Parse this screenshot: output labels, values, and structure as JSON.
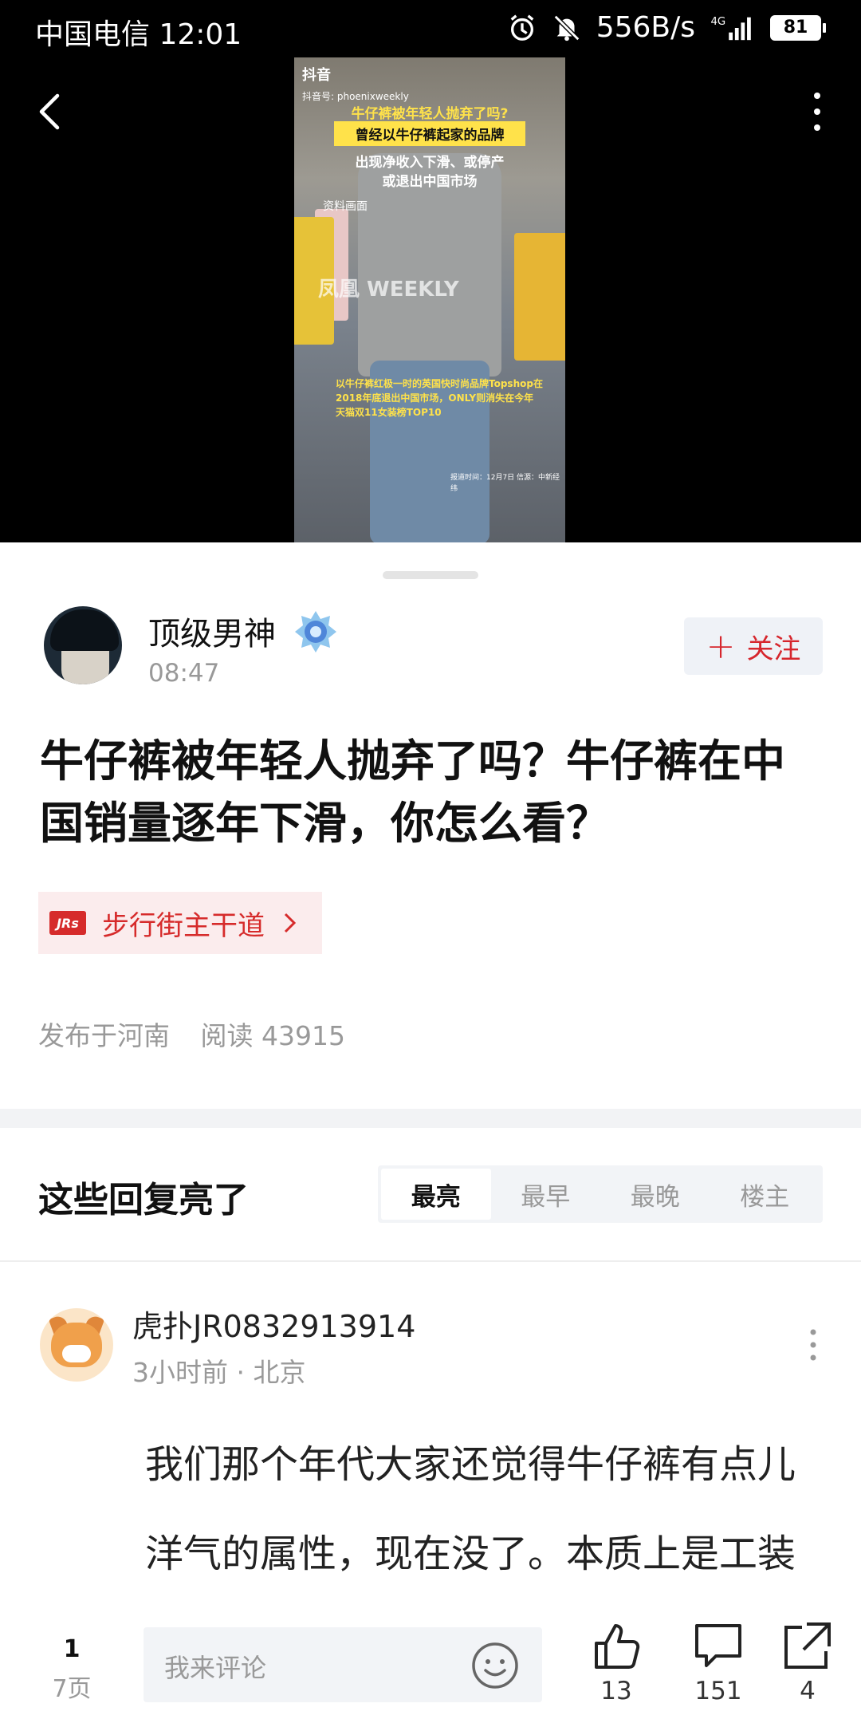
{
  "status_bar": {
    "carrier": "中国电信 12:01",
    "speed": "556B/s",
    "network": "4G",
    "battery": "81"
  },
  "video": {
    "app_logo": "抖音",
    "handle": "抖音号: phoenixweekly",
    "caption_top": "牛仔裤被年轻人抛弃了吗?",
    "caption_highlight": "曾经以牛仔裤起家的品牌",
    "caption_line1": "出现净收入下滑、或停产",
    "caption_line2": "或退出中国市场",
    "caption_source_label": "资料画面",
    "watermark": "凤凰 WEEKLY",
    "caption_bottom": "以牛仔裤红极一时的英国快时尚品牌Topshop在2018年底退出中国市场，ONLY则消失在今年天猫双11女装榜TOP10",
    "caption_report": "报道时间：12月7日 信源：中新经纬"
  },
  "author": {
    "name": "顶级男神",
    "time": "08:47",
    "follow_label": "关注"
  },
  "post": {
    "title": "牛仔裤被年轻人抛弃了吗？牛仔裤在中国销量逐年下滑，你怎么看？",
    "tag_icon": "JRs",
    "tag_label": "步行街主干道",
    "location": "发布于河南",
    "reads": "阅读 43915"
  },
  "replies": {
    "section_title": "这些回复亮了",
    "sort_tabs": [
      "最亮",
      "最早",
      "最晚",
      "楼主"
    ],
    "active_tab": "最亮"
  },
  "comment": {
    "user": "虎扑JR0832913914",
    "meta": "3小时前 · 北京",
    "body": "我们那个年代大家还觉得牛仔裤有点儿洋气的属性，现在没了。本质上是工装裤，就是结实，这个大多"
  },
  "bottom_bar": {
    "page_current": "1",
    "page_total": "7页",
    "input_placeholder": "我来评论",
    "likes": "13",
    "comments": "151",
    "shares": "4"
  },
  "colors": {
    "accent_red": "#d62b2b",
    "muted_gray": "#999999",
    "tab_bg": "#f2f4f7"
  }
}
